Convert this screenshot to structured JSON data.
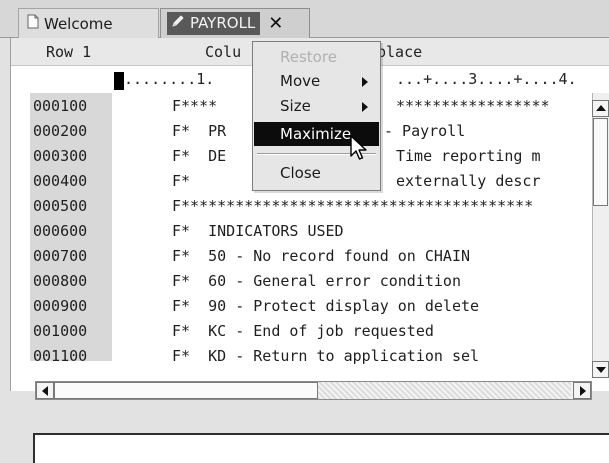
{
  "tabs": [
    {
      "label": "Welcome",
      "icon": "document-icon"
    },
    {
      "label": "PAYROLL",
      "icon": "pencil-edit-icon",
      "close_glyph": "✕"
    }
  ],
  "editor_header": {
    "row_label": "Row 1",
    "col_label_left": "Colu",
    "col_label_right": "place"
  },
  "ruler": {
    "segment_left": "........1.",
    "segment_right": "...+....3....+....4."
  },
  "code_lines": [
    {
      "seq": "000100",
      "code": "F****",
      "tail": "*****************"
    },
    {
      "seq": "000200",
      "code": "F*  PR",
      "tail": "- Payroll"
    },
    {
      "seq": "000300",
      "code": "F*  DE",
      "tail": "Time reporting m"
    },
    {
      "seq": "000400",
      "code": "F*",
      "tail": "externally descr"
    },
    {
      "seq": "000500",
      "code": "F***************************************",
      "tail": ""
    },
    {
      "seq": "000600",
      "code": "F*  INDICATORS USED",
      "tail": ""
    },
    {
      "seq": "000700",
      "code": "F*  50 - No record found on CHAIN",
      "tail": ""
    },
    {
      "seq": "000800",
      "code": "F*  60 - General error condition",
      "tail": ""
    },
    {
      "seq": "000900",
      "code": "F*  90 - Protect display on delete",
      "tail": ""
    },
    {
      "seq": "001000",
      "code": "F*  KC - End of job requested",
      "tail": ""
    },
    {
      "seq": "001100",
      "code": "F*  KD - Return to application sel",
      "tail": ""
    }
  ],
  "context_menu": {
    "items": [
      {
        "label": "Restore",
        "state": "disabled"
      },
      {
        "label": "Move",
        "state": "normal",
        "submenu": true
      },
      {
        "label": "Size",
        "state": "normal",
        "submenu": true
      },
      {
        "label": "Maximize",
        "state": "active"
      },
      {
        "label": "Close",
        "state": "normal"
      }
    ]
  },
  "colors": {
    "menu_highlight": "#0c0c0c",
    "seq_column": "#d8d8d8",
    "active_tab_label": "#595959"
  },
  "command_input": {
    "value": ""
  }
}
